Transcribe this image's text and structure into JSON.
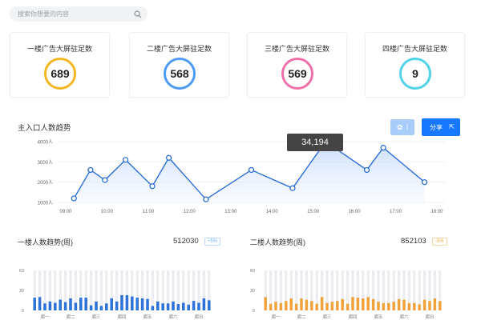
{
  "search": {
    "placeholder": "搜索你想要的内容"
  },
  "cards": [
    {
      "title": "一楼广告大屏驻足数",
      "value": "689",
      "color": "#f5b623"
    },
    {
      "title": "二楼广告大屏驻足数",
      "value": "568",
      "color": "#4c9cf5"
    },
    {
      "title": "三楼广告大屏驻足数",
      "value": "569",
      "color": "#ef6fa8"
    },
    {
      "title": "四楼广告大屏驻足数",
      "value": "9",
      "color": "#52d3e8"
    }
  ],
  "main_chart": {
    "title": "主入口人数趋势",
    "share_label": "分享",
    "gear_suffix": "|",
    "tooltip": "34,194",
    "accent": "#1e66d8"
  },
  "floor1": {
    "title": "一楼人数趋势(周)",
    "total": "512030",
    "badge": "+5%",
    "color": "#2f72d8",
    "badge_color": "#6fb2ff"
  },
  "floor2": {
    "title": "二楼人数趋势(周)",
    "total": "852103",
    "badge": "-5%",
    "color": "#f0a33a",
    "badge_color": "#f0a33a"
  },
  "chart_data": [
    {
      "type": "line",
      "x": [
        "09:00",
        "",
        "10:00",
        "",
        "11:00",
        "",
        "12:00",
        "",
        "13:00",
        "",
        "14:00",
        "",
        "15:00",
        "",
        "16:00",
        "",
        "17:00",
        "",
        "18:00"
      ],
      "xlabels": [
        "09:00",
        "10:00",
        "11:00",
        "12:00",
        "13:00",
        "14:00",
        "15:00",
        "16:00",
        "17:00",
        "18:00"
      ],
      "points": [
        {
          "x": 0.2,
          "y": 1200
        },
        {
          "x": 0.6,
          "y": 2600
        },
        {
          "x": 0.95,
          "y": 2100
        },
        {
          "x": 1.45,
          "y": 3100
        },
        {
          "x": 2.1,
          "y": 1800
        },
        {
          "x": 2.5,
          "y": 3200
        },
        {
          "x": 3.4,
          "y": 1150
        },
        {
          "x": 4.5,
          "y": 2600
        },
        {
          "x": 5.5,
          "y": 1700
        },
        {
          "x": 6.3,
          "y": 4000
        },
        {
          "x": 7.3,
          "y": 2600
        },
        {
          "x": 7.7,
          "y": 3700
        },
        {
          "x": 8.7,
          "y": 2000
        }
      ],
      "yticks": [
        "4000人",
        "3000人",
        "2000人",
        "1000人"
      ],
      "ylim": [
        1000,
        4000
      ],
      "highlight_index": 9
    },
    {
      "type": "bar",
      "categories": [
        "周一",
        "周二",
        "周三",
        "周四",
        "周五",
        "周六",
        "周日"
      ],
      "yticks": [
        "63",
        "30",
        "0"
      ],
      "ylim": [
        0,
        63
      ],
      "values": [
        20,
        21,
        11,
        14,
        12,
        17,
        13,
        19,
        12,
        20,
        20,
        8,
        14,
        7,
        11,
        19,
        14,
        24,
        24,
        22,
        20,
        19,
        18,
        7,
        14,
        11,
        11,
        14,
        10,
        12,
        9,
        15,
        12,
        19,
        16
      ]
    },
    {
      "type": "bar",
      "categories": [
        "周一",
        "周二",
        "周三",
        "周四",
        "周五",
        "周六",
        "周日"
      ],
      "yticks": [
        "60",
        "30",
        "0"
      ],
      "ylim": [
        0,
        60
      ],
      "values": [
        20,
        10,
        13,
        11,
        14,
        18,
        10,
        18,
        16,
        14,
        10,
        20,
        11,
        13,
        14,
        17,
        10,
        20,
        19,
        18,
        20,
        17,
        13,
        11,
        11,
        13,
        17,
        16,
        11,
        11,
        9,
        16,
        14,
        18,
        14
      ]
    }
  ]
}
